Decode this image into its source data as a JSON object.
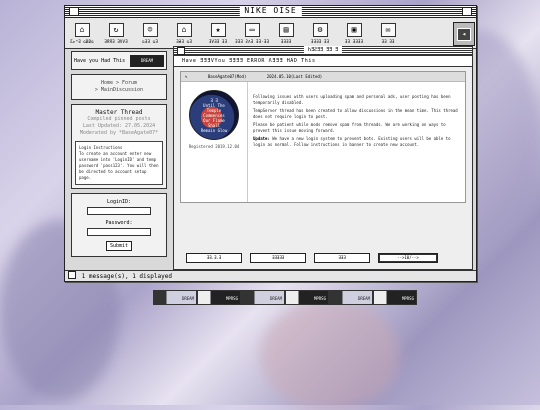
{
  "window": {
    "title": "NIKE OISE"
  },
  "toolbar": {
    "items": [
      {
        "icon": "home-icon",
        "label": "ƸᴘᴴƎ ǤɃɃǤ"
      },
      {
        "icon": "refresh-icon",
        "label": "ƎЯЯƎ ƎVVƎ"
      },
      {
        "icon": "user-icon",
        "label": "ǤƎƎ ǤƎ"
      },
      {
        "icon": "house-icon",
        "label": "ƎӘƎ ǤƎ"
      },
      {
        "icon": "star-icon",
        "label": "ƎVƎƎ ƎƎ"
      },
      {
        "icon": "folder-icon",
        "label": "ƎƎƎ ƧΛƎ ƎƎ·ƎƎ"
      },
      {
        "icon": "doc-icon",
        "label": "ƎƎƎƎ"
      },
      {
        "icon": "gear-icon",
        "label": "ƎƎƎƎ ƎƎ"
      },
      {
        "icon": "save-icon",
        "label": "ƎƎ ƎƎƎƎ"
      },
      {
        "icon": "mail-icon",
        "label": "ƎƎ ƎƎ"
      }
    ]
  },
  "sidebar": {
    "have_you": "Have you Had This",
    "badge": "DREAM",
    "breadcrumb_home": "Home > Forum",
    "breadcrumb_sub": "> MainDiscussion",
    "master_title": "Master Thread",
    "master_sub": "Compiled pinned posts",
    "last_updated": "Last Updated: 27.05.2024",
    "moderated": "Moderated by *BaseAgate07*",
    "instructions": "Login Instructions\nTo create an account enter new username into 'LoginID' and temp password 'pass123'. You will then be directed to account setup page.",
    "login_label": "LoginID:",
    "password_label": "Password:",
    "submit": "Submit"
  },
  "main": {
    "title": "ҺƎƧƎƎ ƎƎ Ǝ",
    "marquee": "Have ƎƎƎVYou ƎƎƎƎ ERROR ΛƎƎƎ HAD This",
    "post_user": "BaseAgate07(Mod)",
    "post_date": "2024.05.10(Last Edited)",
    "avatar_text": "Ǝ Ǝ\nUntil The\nTemple\nCommences\nOur Flame\nShall\nRemain Glow",
    "registered": "Registered 2019.12.04",
    "p1": "Following issues with users uploading spam and personal ads, user posting has been temporarily disabled.",
    "p2": "TempServer thread has been created to allow discussions in the mean time. This thread does not require login to post.",
    "p3": "Please be patient while mods remove spam from threads. We are working on ways to prevent this issue moving forward.",
    "update_label": "Update:",
    "update_text": " We have a new login system to prevent bots. Existing users will be able to login as normal. Follow instructions in banner to create new account.",
    "nav": [
      "ƎƎ.Ǝ.Ǝ",
      "ƎƎƎƎƎ",
      "ƎƎƎ",
      "-->10/-->"
    ]
  },
  "status": {
    "text": "1 message(s), 1 displayed"
  },
  "banners": [
    "DREAM",
    "MPRSG",
    "DREAM",
    "MPRSG",
    "DREAM",
    "MPRSG"
  ]
}
